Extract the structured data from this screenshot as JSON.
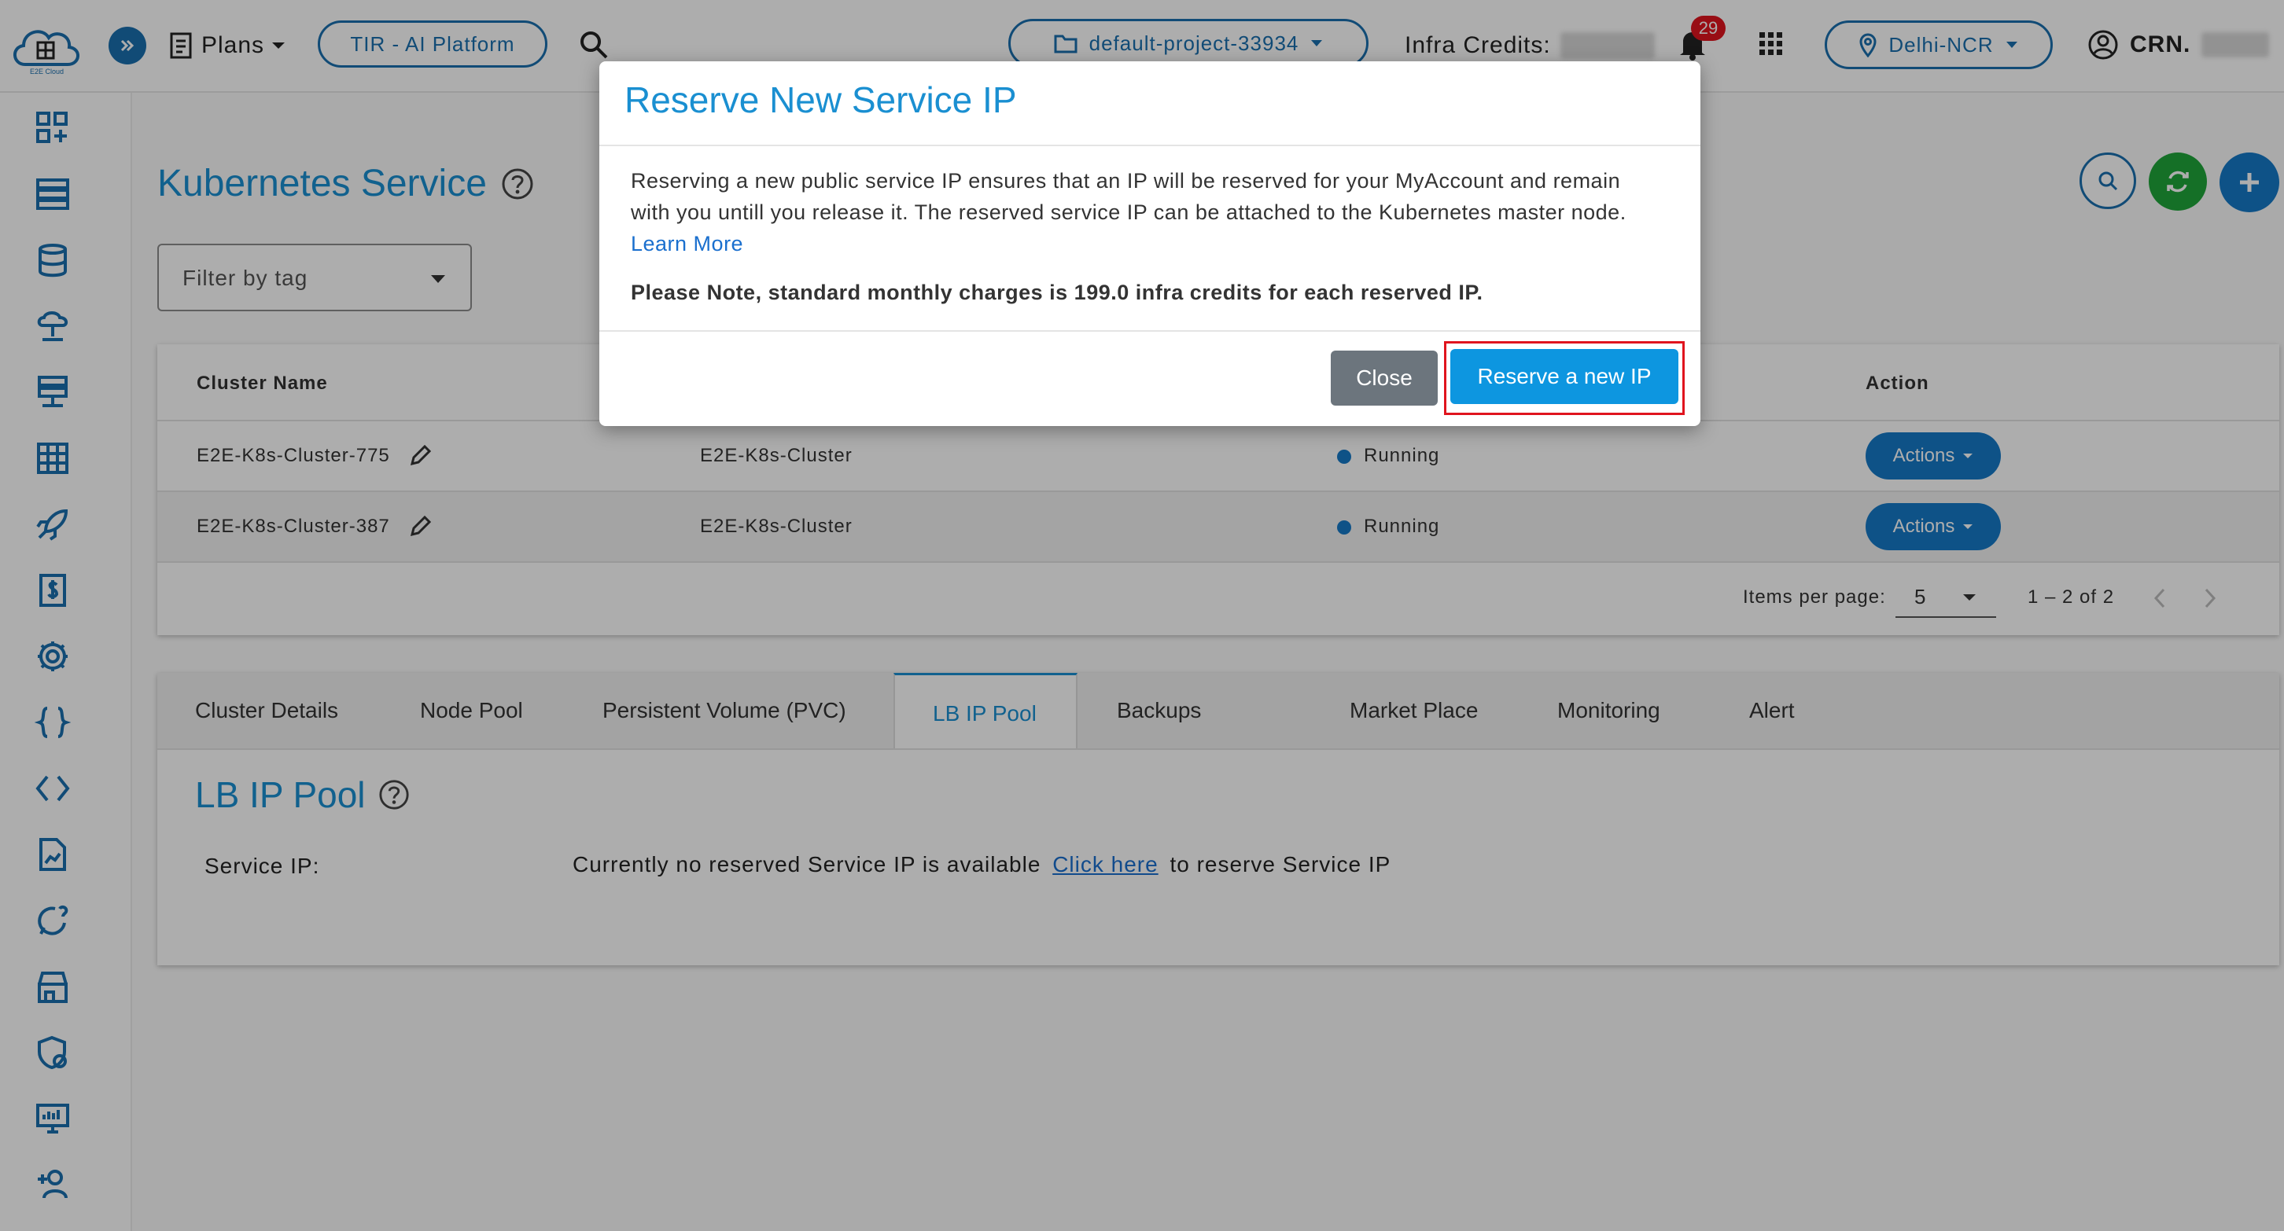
{
  "topbar": {
    "logo_text": "E2E Cloud",
    "plans_label": "Plans",
    "tir_label": "TIR - AI Platform",
    "project_label": "default-project-33934",
    "credits_label": "Infra Credits:",
    "notification_count": "29",
    "region_label": "Delhi-NCR",
    "account_label": "CRN."
  },
  "sidebar": {
    "items": [
      "dashboard-icon",
      "nodes-icon",
      "database-icon",
      "cdn-icon",
      "server-icon",
      "grid-icon",
      "rocket-icon",
      "billing-icon",
      "settings-icon",
      "braces-icon",
      "code-icon",
      "report-icon",
      "support-icon",
      "marketplace-icon",
      "security-icon",
      "monitor-icon",
      "add-user-icon"
    ]
  },
  "page": {
    "title": "Kubernetes Service",
    "filter_placeholder": "Filter by tag"
  },
  "table": {
    "headers": {
      "cluster_name": "Cluster Name",
      "action": "Action"
    },
    "rows": [
      {
        "name": "E2E-K8s-Cluster-775",
        "plan": "E2E-K8s-Cluster",
        "status": "Running",
        "action": "Actions"
      },
      {
        "name": "E2E-K8s-Cluster-387",
        "plan": "E2E-K8s-Cluster",
        "status": "Running",
        "action": "Actions"
      }
    ],
    "status_color": "#1579c7",
    "items_per_page_label": "Items per page:",
    "items_per_page_value": "5",
    "range_label": "1 – 2 of 2"
  },
  "tabs": {
    "items": [
      "Cluster Details",
      "Node Pool",
      "Persistent Volume (PVC)",
      "LB IP Pool",
      "Backups",
      "Market Place",
      "Monitoring",
      "Alert"
    ],
    "active": "LB IP Pool"
  },
  "lb_section": {
    "title": "LB IP Pool",
    "service_ip_label": "Service IP:",
    "message_before": "Currently no reserved Service IP is available",
    "link_text": "Click here",
    "message_after": "to reserve Service IP"
  },
  "modal": {
    "title": "Reserve New Service IP",
    "body_line1": "Reserving a new public service IP ensures that an IP will be reserved for your MyAccount and remain",
    "body_line2": "with you untill you release it. The reserved service IP can be attached to the Kubernetes master node.",
    "learn_more": "Learn More",
    "note": "Please Note, standard monthly charges is 199.0 infra credits for each reserved IP.",
    "close_label": "Close",
    "reserve_label": "Reserve a new IP"
  },
  "colors": {
    "brand": "#1a6fae",
    "title_blue": "#1a8fd1",
    "primary_button": "#0d96e0",
    "close_button": "#6c757d",
    "highlight": "#e0141e",
    "badge": "#e0141e",
    "fab_green": "#1fa53a"
  }
}
